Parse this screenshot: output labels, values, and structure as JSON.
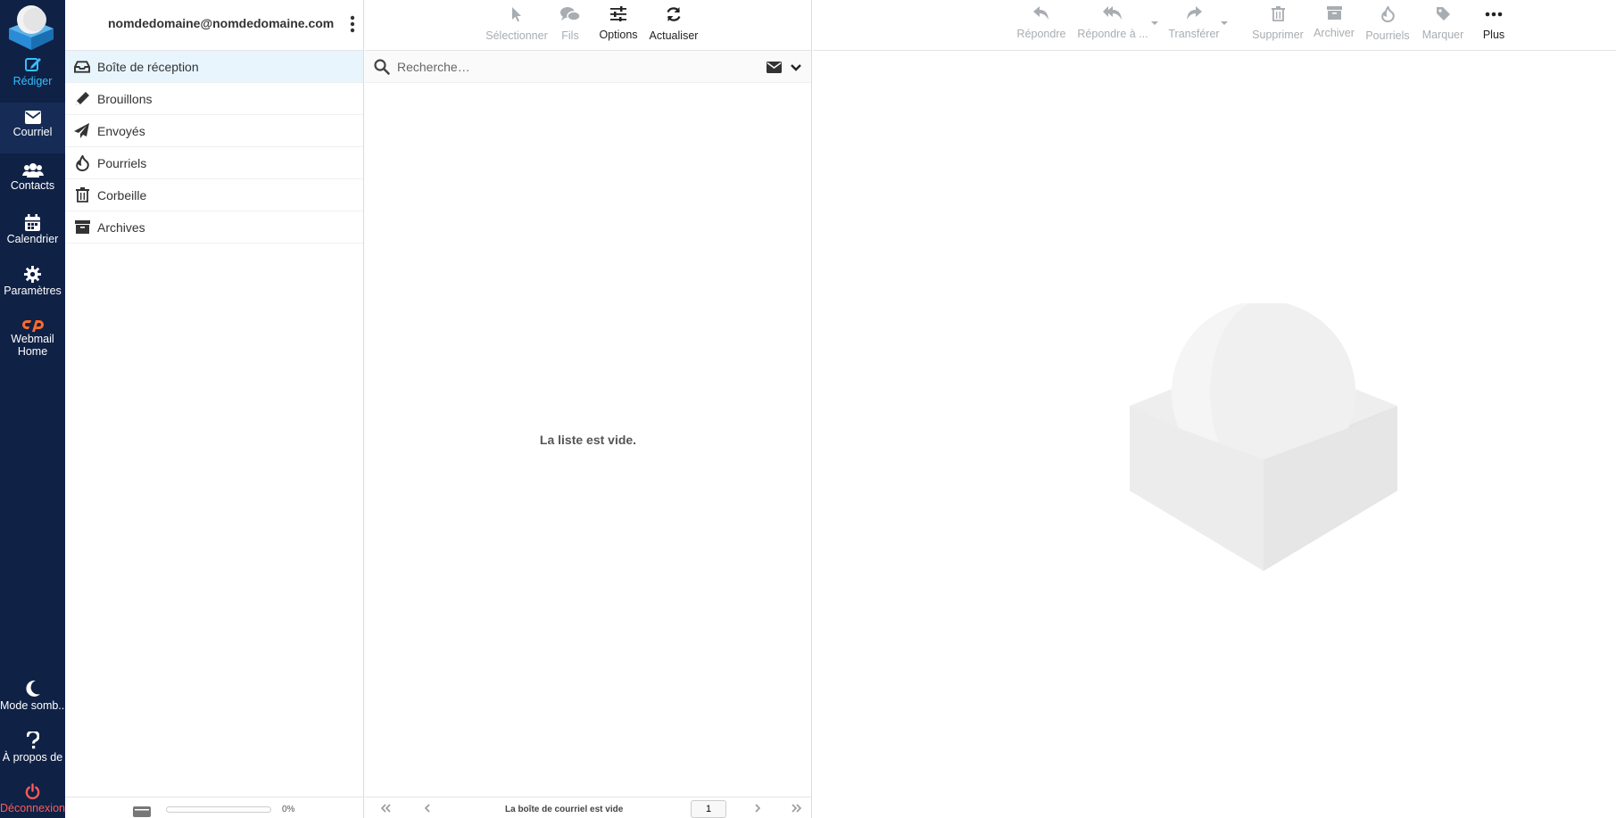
{
  "nav": {
    "compose": "Rédiger",
    "mail": "Courriel",
    "contacts": "Contacts",
    "calendar": "Calendrier",
    "settings": "Paramètres",
    "webmail_home": "Webmail Home",
    "dark_mode": "Mode somb...",
    "about": "À propos de",
    "logout": "Déconnexion"
  },
  "account": {
    "email": "nomdedomaine@nomdedomaine.com"
  },
  "folders": [
    {
      "label": "Boîte de réception",
      "icon": "inbox-icon",
      "selected": true
    },
    {
      "label": "Brouillons",
      "icon": "pencil-icon",
      "selected": false
    },
    {
      "label": "Envoyés",
      "icon": "paper-plane-icon",
      "selected": false
    },
    {
      "label": "Pourriels",
      "icon": "fire-icon",
      "selected": false
    },
    {
      "label": "Corbeille",
      "icon": "trash-icon",
      "selected": false
    },
    {
      "label": "Archives",
      "icon": "archive-icon",
      "selected": false
    }
  ],
  "quota": {
    "percent_text": "0%",
    "percent": 0
  },
  "list_toolbar": {
    "select": "Sélectionner",
    "threads": "Fils",
    "options": "Options",
    "refresh": "Actualiser"
  },
  "search": {
    "placeholder": "Recherche…"
  },
  "list": {
    "empty_message": "La liste est vide.",
    "footer_text": "La boîte de courriel est vide",
    "page": "1"
  },
  "message_toolbar": {
    "reply": "Répondre",
    "reply_all": "Répondre à ...",
    "forward": "Transférer",
    "delete": "Supprimer",
    "archive": "Archiver",
    "junk": "Pourriels",
    "mark": "Marquer",
    "more": "Plus"
  },
  "colors": {
    "nav_bg": "#0f2145",
    "accent": "#37beff",
    "logout": "#ff5a5a",
    "selected_folder": "#e8f5fd"
  }
}
